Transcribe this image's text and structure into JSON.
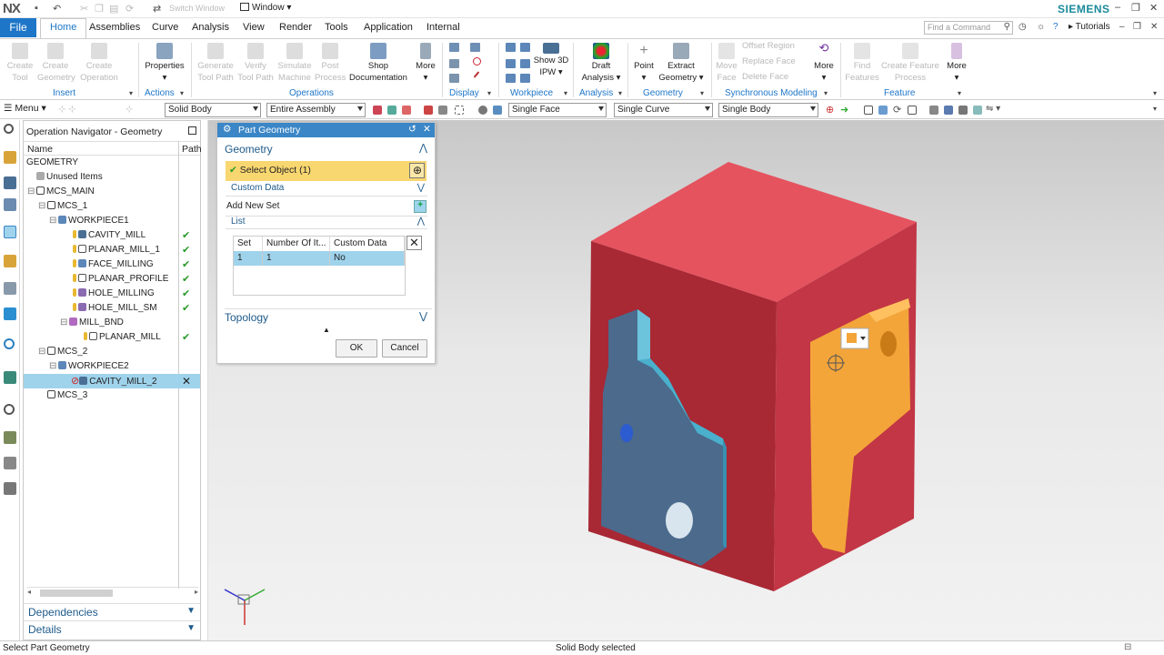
{
  "app": {
    "logo": "NX",
    "brand": "SIEMENS",
    "switch_window": "Switch Window",
    "window_menu": "Window"
  },
  "tabs": [
    {
      "label": "File"
    },
    {
      "label": "Home"
    },
    {
      "label": "Assemblies"
    },
    {
      "label": "Curve"
    },
    {
      "label": "Analysis"
    },
    {
      "label": "View"
    },
    {
      "label": "Render"
    },
    {
      "label": "Tools"
    },
    {
      "label": "Application"
    },
    {
      "label": "Internal"
    }
  ],
  "command_finder": {
    "placeholder": "Find a Command"
  },
  "tutorials": "Tutorials",
  "ribbon": {
    "insert": {
      "group": "Insert",
      "create_tool": [
        "Create",
        "Tool"
      ],
      "create_geometry": [
        "Create",
        "Geometry"
      ],
      "create_operation": [
        "Create",
        "Operation"
      ]
    },
    "actions": {
      "group": "Actions",
      "properties": "Properties"
    },
    "operations": {
      "group": "Operations",
      "generate": [
        "Generate",
        "Tool Path"
      ],
      "verify": [
        "Verify",
        "Tool Path"
      ],
      "simulate": [
        "Simulate",
        "Machine"
      ],
      "post": [
        "Post",
        "Process"
      ],
      "shop_doc": [
        "Shop",
        "Documentation"
      ],
      "more": "More"
    },
    "display": {
      "group": "Display"
    },
    "workpiece": {
      "group": "Workpiece",
      "show3d": [
        "Show 3D",
        "IPW"
      ]
    },
    "analysis": {
      "group": "Analysis",
      "draft": [
        "Draft",
        "Analysis"
      ]
    },
    "geometry": {
      "group": "Geometry",
      "point": "Point",
      "extract": [
        "Extract",
        "Geometry"
      ]
    },
    "sync": {
      "group": "Synchronous Modeling",
      "move_face": [
        "Move",
        "Face"
      ],
      "offset_region": "Offset Region",
      "replace_face": "Replace Face",
      "delete_face": "Delete Face",
      "more": "More"
    },
    "feature": {
      "group": "Feature",
      "find": [
        "Find",
        "Features"
      ],
      "create_feature": [
        "Create Feature",
        "Process"
      ],
      "more": "More"
    }
  },
  "selection_bar": {
    "menu": "Menu",
    "filter1": "Solid Body",
    "filter2": "Entire Assembly",
    "face_rule": "Single Face",
    "curve_rule": "Single Curve",
    "body_rule": "Single Body"
  },
  "navigator": {
    "title": "Operation Navigator - Geometry",
    "col_name": "Name",
    "col_path": "Path",
    "rows": [
      {
        "label": "GEOMETRY",
        "status": ""
      },
      {
        "label": "Unused Items",
        "status": ""
      },
      {
        "label": "MCS_MAIN",
        "status": ""
      },
      {
        "label": "MCS_1",
        "status": ""
      },
      {
        "label": "WORKPIECE1",
        "status": ""
      },
      {
        "label": "CAVITY_MILL",
        "status": "✔"
      },
      {
        "label": "PLANAR_MILL_1",
        "status": "✔"
      },
      {
        "label": "FACE_MILLING",
        "status": "✔"
      },
      {
        "label": "PLANAR_PROFILE",
        "status": "✔"
      },
      {
        "label": "HOLE_MILLING",
        "status": "✔"
      },
      {
        "label": "HOLE_MILL_SM",
        "status": "✔"
      },
      {
        "label": "MILL_BND",
        "status": ""
      },
      {
        "label": "PLANAR_MILL",
        "status": "✔"
      },
      {
        "label": "MCS_2",
        "status": ""
      },
      {
        "label": "WORKPIECE2",
        "status": ""
      },
      {
        "label": "CAVITY_MILL_2",
        "status": "✕"
      },
      {
        "label": "MCS_3",
        "status": ""
      }
    ],
    "dependencies": "Dependencies",
    "details": "Details"
  },
  "dialog": {
    "title": "Part Geometry",
    "geometry": "Geometry",
    "select_object": "Select Object (1)",
    "custom_data": "Custom Data",
    "add_new_set": "Add New Set",
    "list": "List",
    "table_headers": [
      "Set",
      "Number Of It...",
      "Custom Data"
    ],
    "table_row": [
      "1",
      "1",
      "No"
    ],
    "topology": "Topology",
    "ok": "OK",
    "cancel": "Cancel"
  },
  "status": {
    "left": "Select Part Geometry",
    "center": "Solid Body selected"
  },
  "colors": {
    "accent": "#1e76c8",
    "stock": "#d9404f",
    "part_blue": "#4ab0cc",
    "part_orange": "#f3a53a",
    "selection": "#9fd3ec",
    "select_yellow": "#f9d770"
  }
}
